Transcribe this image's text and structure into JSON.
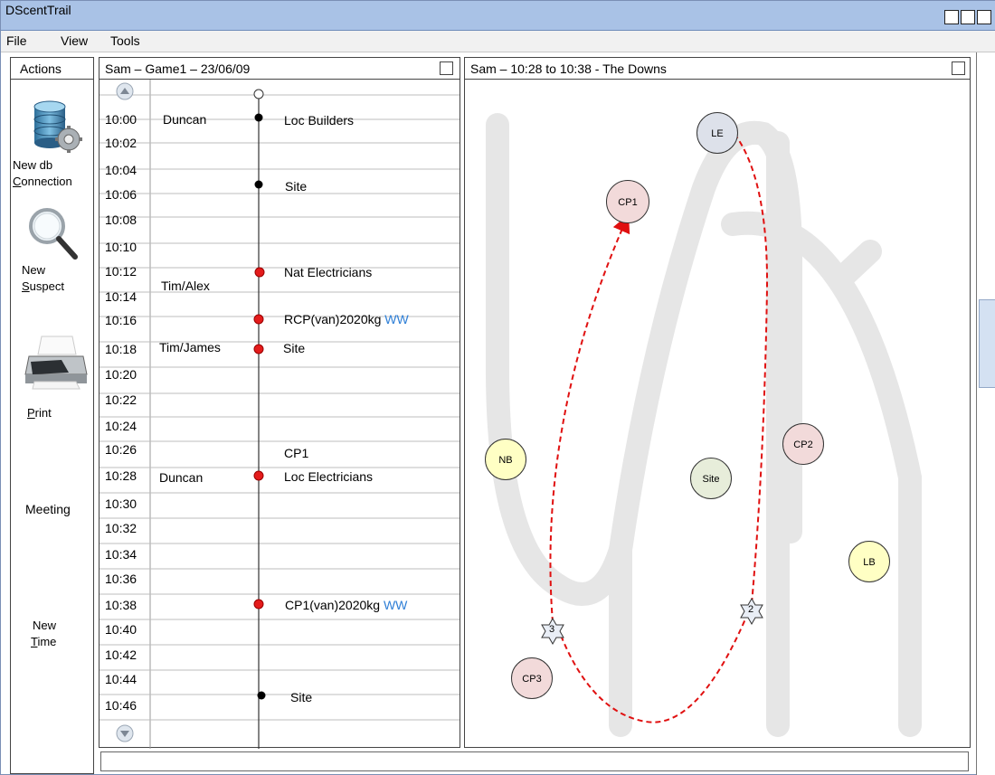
{
  "app": {
    "title": "DScentTrail"
  },
  "menu": {
    "file": "File",
    "view": "View",
    "tools": "Tools"
  },
  "actions": {
    "header": "Actions",
    "new_db": {
      "line1": "New db",
      "line2": "Connection",
      "icon": "database-gear-icon"
    },
    "new_suspect": {
      "line1": "New",
      "line2": "Suspect",
      "icon": "magnifier-icon"
    },
    "print": {
      "label": "Print",
      "icon": "printer-icon"
    },
    "meeting": {
      "label": "Meeting"
    },
    "new_time": {
      "line1": "New",
      "line2": "Time"
    }
  },
  "timeline": {
    "title": "Sam – Game1 – 23/06/09",
    "times": [
      "10:00",
      "10:02",
      "10:04",
      "10:06",
      "10:08",
      "10:10",
      "10:12",
      "10:14",
      "10:16",
      "10:18",
      "10:20",
      "10:22",
      "10:24",
      "10:26",
      "10:28",
      "10:30",
      "10:32",
      "10:34",
      "10:36",
      "10:38",
      "10:40",
      "10:42",
      "10:44",
      "10:46"
    ],
    "names": [
      "Duncan",
      "Tim/Alex",
      "Tim/James",
      "Duncan"
    ],
    "events": {
      "e1": "Loc Builders",
      "e2": "Site",
      "e3": "Nat Electricians",
      "e4": "RCP(van)2020kg",
      "e4_tag": "WW",
      "e5": "Site",
      "e6": "CP1",
      "e7": "Loc Electricians",
      "e8": "CP1(van)2020kg",
      "e8_tag": "WW",
      "e9": "Site"
    }
  },
  "map": {
    "title": "Sam – 10:28 to 10:38 - The Downs",
    "nodes": {
      "LE": "LE",
      "CP1": "CP1",
      "CP2": "CP2",
      "NB": "NB",
      "Site": "Site",
      "LB": "LB",
      "CP3": "CP3"
    },
    "markers": {
      "m2": "2",
      "m3": "3"
    },
    "colors": {
      "route": "#e01010",
      "pink": "#f2dada",
      "yellow": "#ffffc4",
      "grey": "#dde1ea",
      "greenish": "#e7edda"
    }
  }
}
